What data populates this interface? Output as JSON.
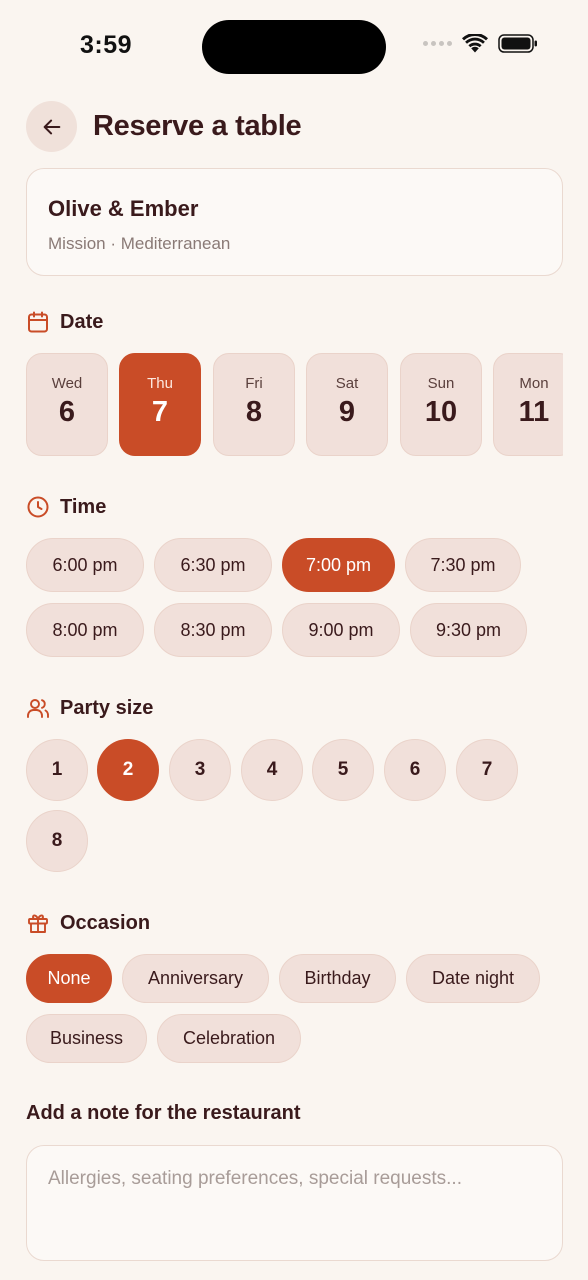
{
  "status_bar": {
    "time": "3:59"
  },
  "header": {
    "title": "Reserve a table"
  },
  "restaurant": {
    "name": "Olive & Ember",
    "meta": "Mission · Mediterranean"
  },
  "sections": {
    "date": "Date",
    "time": "Time",
    "party_size": "Party size",
    "occasion": "Occasion"
  },
  "dates": [
    {
      "dow": "Wed",
      "day": "6"
    },
    {
      "dow": "Thu",
      "day": "7"
    },
    {
      "dow": "Fri",
      "day": "8"
    },
    {
      "dow": "Sat",
      "day": "9"
    },
    {
      "dow": "Sun",
      "day": "10"
    },
    {
      "dow": "Mon",
      "day": "11"
    }
  ],
  "selected_date_index": 1,
  "times": [
    "6:00 pm",
    "6:30 pm",
    "7:00 pm",
    "7:30 pm",
    "8:00 pm",
    "8:30 pm",
    "9:00 pm",
    "9:30 pm"
  ],
  "selected_time_index": 2,
  "party_sizes": [
    "1",
    "2",
    "3",
    "4",
    "5",
    "6",
    "7",
    "8"
  ],
  "selected_party_index": 1,
  "occasions": [
    "None",
    "Anniversary",
    "Birthday",
    "Date night",
    "Business",
    "Celebration"
  ],
  "selected_occasion_index": 0,
  "note": {
    "label": "Add a note for the restaurant",
    "placeholder": "Allergies, seating preferences, special requests...",
    "value": ""
  },
  "colors": {
    "accent": "#c94c27",
    "background": "#faf5f0",
    "chip": "#f1e0da",
    "text": "#3a1a1c"
  },
  "icons": {
    "back": "arrow-left-icon",
    "date": "calendar-icon",
    "time": "clock-icon",
    "party": "users-icon",
    "occasion": "gift-icon"
  }
}
